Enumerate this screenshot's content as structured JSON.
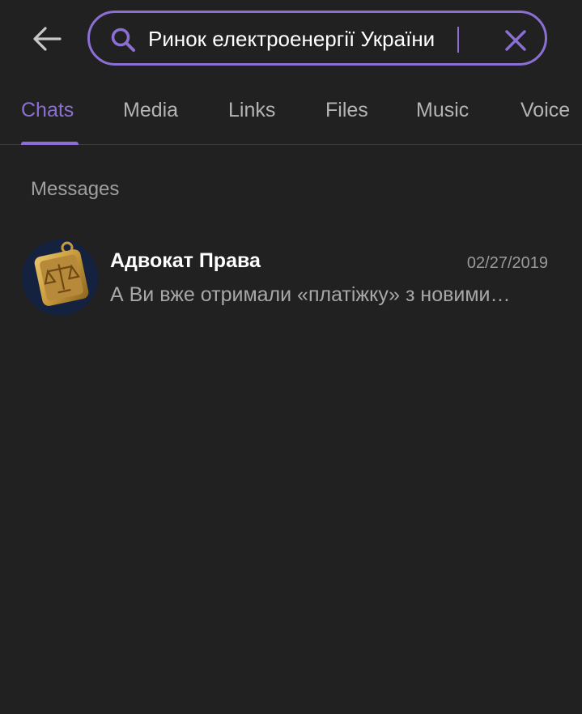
{
  "search": {
    "value": "Ринок електроенергії України"
  },
  "tabs": [
    {
      "label": "Chats",
      "active": true
    },
    {
      "label": "Media",
      "active": false
    },
    {
      "label": "Links",
      "active": false
    },
    {
      "label": "Files",
      "active": false
    },
    {
      "label": "Music",
      "active": false
    },
    {
      "label": "Voice",
      "active": false
    }
  ],
  "messages": {
    "section_title": "Messages",
    "results": [
      {
        "name": "Адвокат Права",
        "date": "02/27/2019",
        "preview": "А Ви вже отримали «платіжку» з новими…",
        "avatar_icon": "scales-of-justice-pendant"
      }
    ]
  },
  "colors": {
    "accent": "#8b6fd4",
    "background": "#212121",
    "primary_text": "#ffffff",
    "secondary_text": "#a8a8a8"
  },
  "icons": {
    "back": "arrow-left-icon",
    "search": "search-icon",
    "clear": "close-icon"
  }
}
